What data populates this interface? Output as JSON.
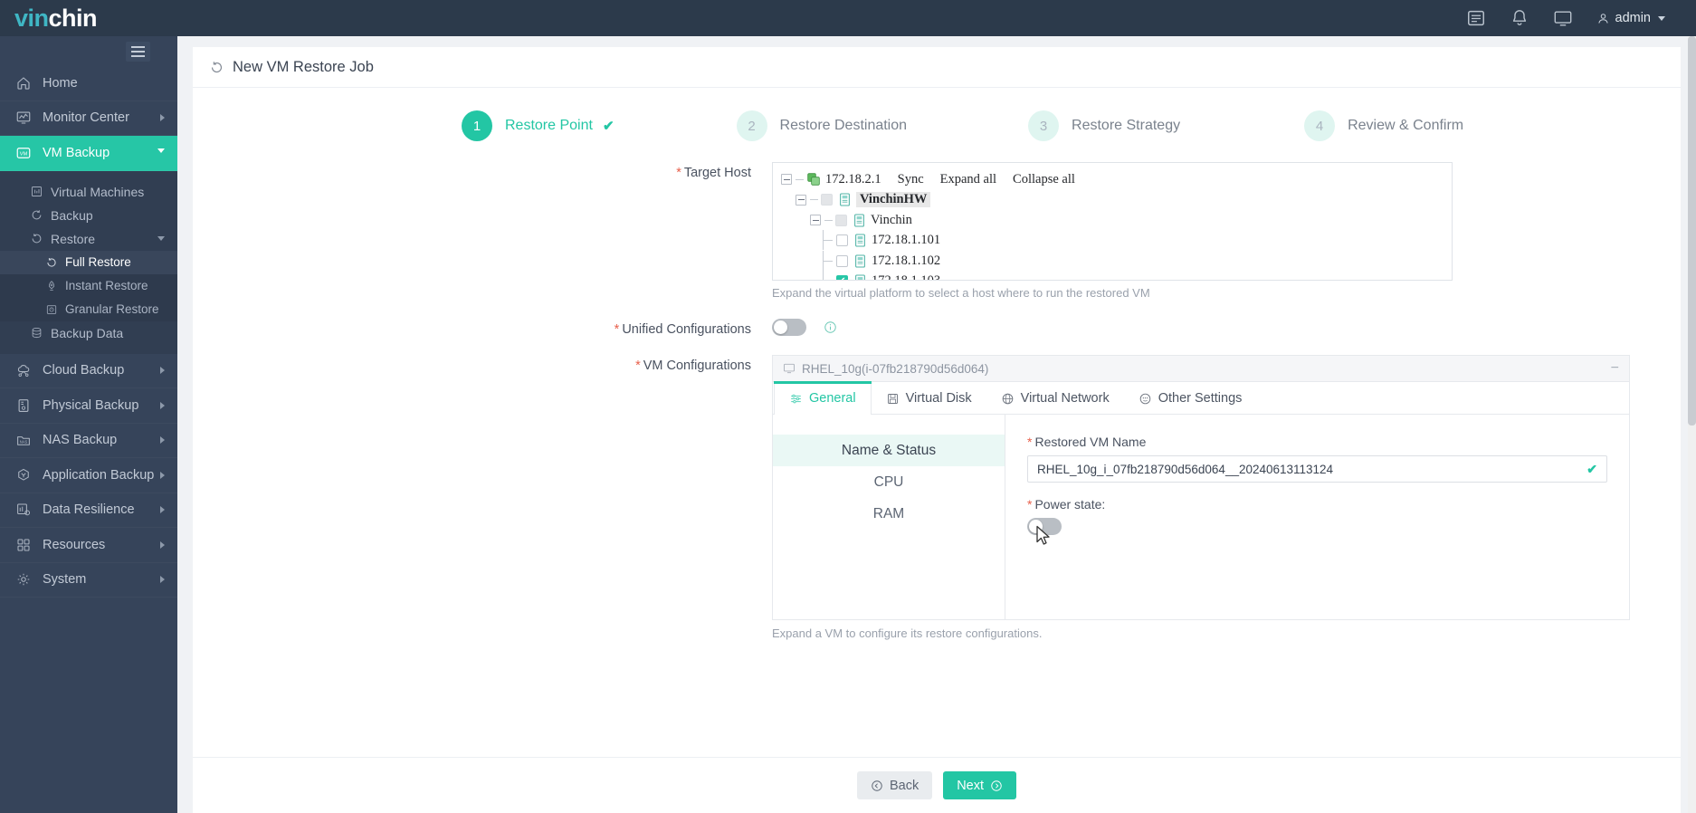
{
  "brand": {
    "part1": "vin",
    "part2": "chin"
  },
  "topbar": {
    "icons": [
      "list-icon",
      "bell-icon",
      "monitor-icon"
    ],
    "user": "admin"
  },
  "sidebar": {
    "hamburger": "menu-toggle",
    "items": [
      {
        "label": "Home",
        "icon": "home-icon",
        "level": 0,
        "state": "normal",
        "arrow": false
      },
      {
        "label": "Monitor Center",
        "icon": "monitor-chart-icon",
        "level": 0,
        "state": "normal",
        "arrow": true
      },
      {
        "label": "VM Backup",
        "icon": "vm-icon",
        "level": 0,
        "state": "active",
        "arrow": true
      },
      {
        "label": "Virtual Machines",
        "icon": "virtual-machines-icon",
        "level": 1,
        "state": "normal"
      },
      {
        "label": "Backup",
        "icon": "backup-icon",
        "level": 1,
        "state": "normal"
      },
      {
        "label": "Restore",
        "icon": "restore-icon",
        "level": 1,
        "state": "expanded",
        "arrow": true
      },
      {
        "label": "Full Restore",
        "icon": "full-restore-icon",
        "level": 2,
        "state": "current"
      },
      {
        "label": "Instant Restore",
        "icon": "instant-restore-icon",
        "level": 2,
        "state": "normal"
      },
      {
        "label": "Granular Restore",
        "icon": "granular-restore-icon",
        "level": 2,
        "state": "normal"
      },
      {
        "label": "Backup Data",
        "icon": "database-icon",
        "level": 1,
        "state": "normal"
      },
      {
        "label": "Cloud Backup",
        "icon": "cloud-backup-icon",
        "level": 0,
        "state": "normal",
        "arrow": true
      },
      {
        "label": "Physical Backup",
        "icon": "physical-backup-icon",
        "level": 0,
        "state": "normal",
        "arrow": true
      },
      {
        "label": "NAS Backup",
        "icon": "nas-backup-icon",
        "level": 0,
        "state": "normal",
        "arrow": true
      },
      {
        "label": "Application Backup",
        "icon": "application-backup-icon",
        "level": 0,
        "state": "normal",
        "arrow": true
      },
      {
        "label": "Data Resilience",
        "icon": "data-resilience-icon",
        "level": 0,
        "state": "normal",
        "arrow": true
      },
      {
        "label": "Resources",
        "icon": "resources-icon",
        "level": 0,
        "state": "normal",
        "arrow": true
      },
      {
        "label": "System",
        "icon": "system-icon",
        "level": 0,
        "state": "normal",
        "arrow": true
      }
    ]
  },
  "page": {
    "title": "New VM Restore Job",
    "title_icon": "restore-icon"
  },
  "steps": [
    {
      "num": "1",
      "label": "Restore Point",
      "state": "done",
      "check": "✔"
    },
    {
      "num": "2",
      "label": "Restore Destination",
      "state": "todo"
    },
    {
      "num": "3",
      "label": "Restore Strategy",
      "state": "todo"
    },
    {
      "num": "4",
      "label": "Review & Confirm",
      "state": "todo"
    }
  ],
  "target_host": {
    "label": "Target Host",
    "required": true,
    "hint": "Expand the virtual platform to select a host where to run the restored VM",
    "root": {
      "name": "172.18.2.1",
      "icon": "platform-icon"
    },
    "links": [
      "Sync",
      "Expand all",
      "Collapse all"
    ],
    "nodes": [
      {
        "name": "VinchinHW",
        "level": 1,
        "checkbox": "grey",
        "highlight": true,
        "expandable": true
      },
      {
        "name": "Vinchin",
        "level": 2,
        "checkbox": "grey",
        "highlight": false,
        "expandable": true
      },
      {
        "name": "172.18.1.101",
        "level": 3,
        "checkbox": "empty",
        "highlight": false,
        "expandable": false
      },
      {
        "name": "172.18.1.102",
        "level": 3,
        "checkbox": "empty",
        "highlight": false,
        "expandable": false
      },
      {
        "name": "172.18.1.103",
        "level": 3,
        "checkbox": "checked",
        "highlight": false,
        "expandable": false
      }
    ]
  },
  "unified_configurations": {
    "label": "Unified Configurations",
    "required": true,
    "toggle_on": false,
    "info_icon": "info-icon"
  },
  "vm_configurations": {
    "label": "VM Configurations",
    "required": true,
    "hint": "Expand a VM to configure its restore configurations.",
    "card_title": "RHEL_10g(i-07fb218790d56d064)",
    "card_icon": "monitor-small-icon",
    "collapse_icon": "minus-icon",
    "tabs": [
      {
        "label": "General",
        "icon": "sliders-icon",
        "active": true
      },
      {
        "label": "Virtual Disk",
        "icon": "disk-icon",
        "active": false
      },
      {
        "label": "Virtual Network",
        "icon": "globe-icon",
        "active": false
      },
      {
        "label": "Other Settings",
        "icon": "other-settings-icon",
        "active": false
      }
    ],
    "side_items": [
      {
        "label": "Name & Status",
        "active": true
      },
      {
        "label": "CPU",
        "active": false
      },
      {
        "label": "RAM",
        "active": false
      }
    ],
    "fields": {
      "restored_vm_name_label": "Restored VM Name",
      "restored_vm_name_value": "RHEL_10g_i_07fb218790d56d064__20240613113124",
      "restored_vm_name_valid": "✔",
      "power_state_label": "Power state:",
      "power_state_on": false
    }
  },
  "footer": {
    "back": "Back",
    "back_icon": "arrow-left-circle-icon",
    "next": "Next",
    "next_icon": "arrow-right-circle-icon"
  },
  "colors": {
    "accent": "#23c6a4",
    "sidebar": "#36445a",
    "topbar": "#2c3a4b",
    "required": "#e8604c"
  }
}
